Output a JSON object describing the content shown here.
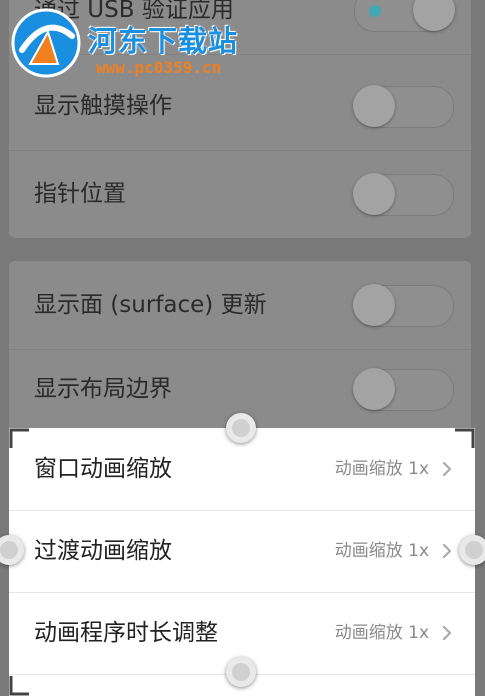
{
  "settings": {
    "group1": [
      {
        "label": "通过 USB 验证应用"
      },
      {
        "label": "显示触摸操作"
      },
      {
        "label": "指针位置"
      }
    ],
    "group2": [
      {
        "label": "显示面 (surface) 更新"
      },
      {
        "label": "显示布局边界"
      }
    ],
    "animation": [
      {
        "label": "窗口动画缩放",
        "value": "动画缩放 1x"
      },
      {
        "label": "过渡动画缩放",
        "value": "动画缩放 1x"
      },
      {
        "label": "动画程序时长调整",
        "value": "动画缩放 1x"
      }
    ]
  },
  "watermark": {
    "title": "河东下载站",
    "url": "www.pc0359.cn"
  },
  "colors": {
    "accent": "#3fa8b0",
    "watermark_blue": "#1a8fe0",
    "watermark_orange": "#f08020"
  }
}
